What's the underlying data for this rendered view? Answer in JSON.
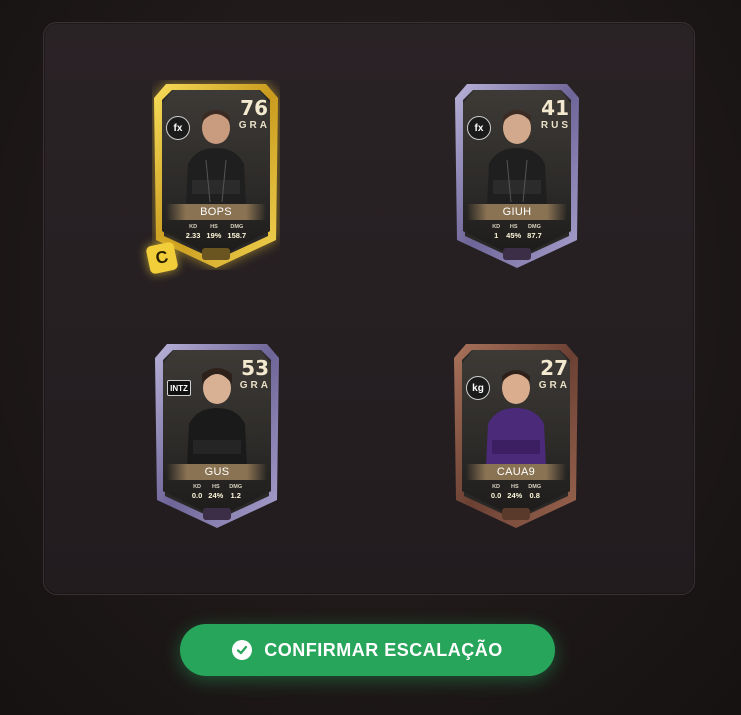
{
  "cards": [
    {
      "rating": "76",
      "position": "GRA",
      "name": "BOPS",
      "team": "fx",
      "stats": [
        {
          "label": "KD",
          "value": "2.33"
        },
        {
          "label": "HS",
          "value": "19%"
        },
        {
          "label": "DMG",
          "value": "158.7"
        }
      ],
      "tier": "gold",
      "jersey": "#1f1f1f"
    },
    {
      "rating": "41",
      "position": "RUS",
      "name": "GIUH",
      "team": "fx",
      "stats": [
        {
          "label": "KD",
          "value": "1"
        },
        {
          "label": "HS",
          "value": "45%"
        },
        {
          "label": "DMG",
          "value": "87.7"
        }
      ],
      "tier": "purple",
      "jersey": "#1f1f1f"
    },
    {
      "rating": "53",
      "position": "GRA",
      "name": "GUS",
      "team": "INTZ",
      "stats": [
        {
          "label": "KD",
          "value": "0.0"
        },
        {
          "label": "HS",
          "value": "24%"
        },
        {
          "label": "DMG",
          "value": "1.2"
        }
      ],
      "tier": "purple",
      "jersey": "#1a1a1a"
    },
    {
      "rating": "27",
      "position": "GRA",
      "name": "CAUA9",
      "team": "kg",
      "stats": [
        {
          "label": "KD",
          "value": "0.0"
        },
        {
          "label": "HS",
          "value": "24%"
        },
        {
          "label": "DMG",
          "value": "0.8"
        }
      ],
      "tier": "bronze",
      "jersey": "#4b2a7a"
    }
  ],
  "captain_badge": "C",
  "confirm_button": {
    "label": "CONFIRMAR ESCALAÇÃO",
    "icon": "check-circle-icon"
  },
  "colors": {
    "gold": "#e9c233",
    "purple": "#8f86b6",
    "bronze": "#8a5a45",
    "confirm": "#27a55b"
  }
}
